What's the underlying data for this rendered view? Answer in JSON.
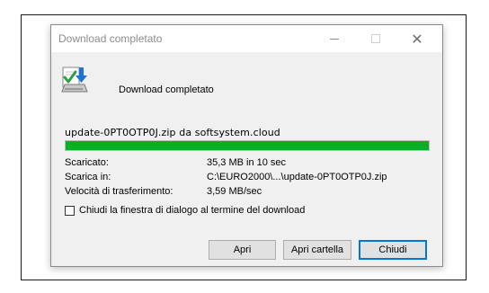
{
  "window": {
    "title": "Download completato",
    "controls": {
      "minimize": "—",
      "maximize": "□",
      "close": "✕"
    }
  },
  "header": {
    "label": "Download completato",
    "icon": "download-complete-icon"
  },
  "download": {
    "file_line": "update-0PT0OTP0J.zip da softsystem.cloud",
    "progress_fraction": 1.0,
    "progress_color": "#06b025"
  },
  "info": [
    {
      "label": "Scaricato:",
      "value": "35,3 MB in 10 sec"
    },
    {
      "label": "Scarica in:",
      "value": "C:\\EURO2000\\...\\update-0PT0OTP0J.zip"
    },
    {
      "label": "Velocità di trasferimento:",
      "value": "3,59 MB/sec"
    }
  ],
  "checkbox": {
    "label": "Chiudi la finestra di dialogo al termine del download",
    "checked": false
  },
  "buttons": {
    "open": "Apri",
    "open_folder": "Apri cartella",
    "close": "Chiudi"
  }
}
